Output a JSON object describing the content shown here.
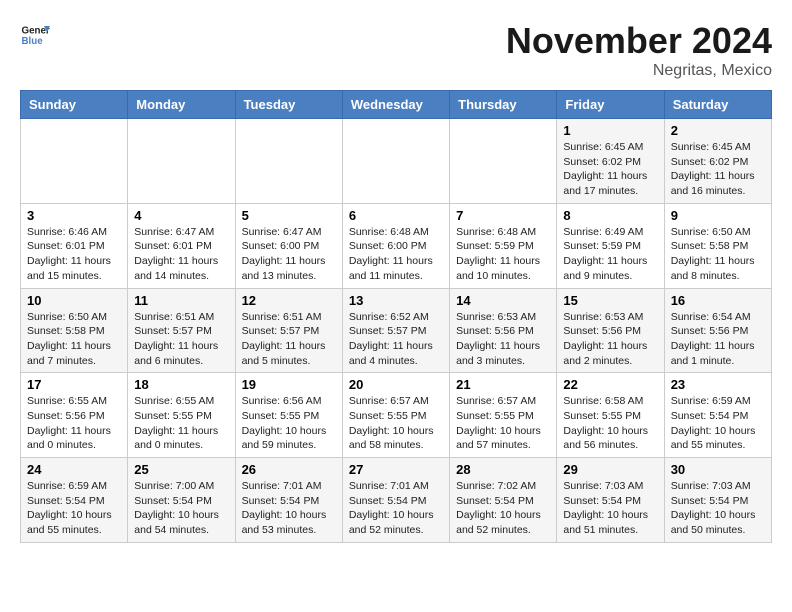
{
  "logo": {
    "line1": "General",
    "line2": "Blue"
  },
  "title": "November 2024",
  "location": "Negritas, Mexico",
  "days_header": [
    "Sunday",
    "Monday",
    "Tuesday",
    "Wednesday",
    "Thursday",
    "Friday",
    "Saturday"
  ],
  "weeks": [
    [
      {
        "day": "",
        "info": ""
      },
      {
        "day": "",
        "info": ""
      },
      {
        "day": "",
        "info": ""
      },
      {
        "day": "",
        "info": ""
      },
      {
        "day": "",
        "info": ""
      },
      {
        "day": "1",
        "info": "Sunrise: 6:45 AM\nSunset: 6:02 PM\nDaylight: 11 hours and 17 minutes."
      },
      {
        "day": "2",
        "info": "Sunrise: 6:45 AM\nSunset: 6:02 PM\nDaylight: 11 hours and 16 minutes."
      }
    ],
    [
      {
        "day": "3",
        "info": "Sunrise: 6:46 AM\nSunset: 6:01 PM\nDaylight: 11 hours and 15 minutes."
      },
      {
        "day": "4",
        "info": "Sunrise: 6:47 AM\nSunset: 6:01 PM\nDaylight: 11 hours and 14 minutes."
      },
      {
        "day": "5",
        "info": "Sunrise: 6:47 AM\nSunset: 6:00 PM\nDaylight: 11 hours and 13 minutes."
      },
      {
        "day": "6",
        "info": "Sunrise: 6:48 AM\nSunset: 6:00 PM\nDaylight: 11 hours and 11 minutes."
      },
      {
        "day": "7",
        "info": "Sunrise: 6:48 AM\nSunset: 5:59 PM\nDaylight: 11 hours and 10 minutes."
      },
      {
        "day": "8",
        "info": "Sunrise: 6:49 AM\nSunset: 5:59 PM\nDaylight: 11 hours and 9 minutes."
      },
      {
        "day": "9",
        "info": "Sunrise: 6:50 AM\nSunset: 5:58 PM\nDaylight: 11 hours and 8 minutes."
      }
    ],
    [
      {
        "day": "10",
        "info": "Sunrise: 6:50 AM\nSunset: 5:58 PM\nDaylight: 11 hours and 7 minutes."
      },
      {
        "day": "11",
        "info": "Sunrise: 6:51 AM\nSunset: 5:57 PM\nDaylight: 11 hours and 6 minutes."
      },
      {
        "day": "12",
        "info": "Sunrise: 6:51 AM\nSunset: 5:57 PM\nDaylight: 11 hours and 5 minutes."
      },
      {
        "day": "13",
        "info": "Sunrise: 6:52 AM\nSunset: 5:57 PM\nDaylight: 11 hours and 4 minutes."
      },
      {
        "day": "14",
        "info": "Sunrise: 6:53 AM\nSunset: 5:56 PM\nDaylight: 11 hours and 3 minutes."
      },
      {
        "day": "15",
        "info": "Sunrise: 6:53 AM\nSunset: 5:56 PM\nDaylight: 11 hours and 2 minutes."
      },
      {
        "day": "16",
        "info": "Sunrise: 6:54 AM\nSunset: 5:56 PM\nDaylight: 11 hours and 1 minute."
      }
    ],
    [
      {
        "day": "17",
        "info": "Sunrise: 6:55 AM\nSunset: 5:56 PM\nDaylight: 11 hours and 0 minutes."
      },
      {
        "day": "18",
        "info": "Sunrise: 6:55 AM\nSunset: 5:55 PM\nDaylight: 11 hours and 0 minutes."
      },
      {
        "day": "19",
        "info": "Sunrise: 6:56 AM\nSunset: 5:55 PM\nDaylight: 10 hours and 59 minutes."
      },
      {
        "day": "20",
        "info": "Sunrise: 6:57 AM\nSunset: 5:55 PM\nDaylight: 10 hours and 58 minutes."
      },
      {
        "day": "21",
        "info": "Sunrise: 6:57 AM\nSunset: 5:55 PM\nDaylight: 10 hours and 57 minutes."
      },
      {
        "day": "22",
        "info": "Sunrise: 6:58 AM\nSunset: 5:55 PM\nDaylight: 10 hours and 56 minutes."
      },
      {
        "day": "23",
        "info": "Sunrise: 6:59 AM\nSunset: 5:54 PM\nDaylight: 10 hours and 55 minutes."
      }
    ],
    [
      {
        "day": "24",
        "info": "Sunrise: 6:59 AM\nSunset: 5:54 PM\nDaylight: 10 hours and 55 minutes."
      },
      {
        "day": "25",
        "info": "Sunrise: 7:00 AM\nSunset: 5:54 PM\nDaylight: 10 hours and 54 minutes."
      },
      {
        "day": "26",
        "info": "Sunrise: 7:01 AM\nSunset: 5:54 PM\nDaylight: 10 hours and 53 minutes."
      },
      {
        "day": "27",
        "info": "Sunrise: 7:01 AM\nSunset: 5:54 PM\nDaylight: 10 hours and 52 minutes."
      },
      {
        "day": "28",
        "info": "Sunrise: 7:02 AM\nSunset: 5:54 PM\nDaylight: 10 hours and 52 minutes."
      },
      {
        "day": "29",
        "info": "Sunrise: 7:03 AM\nSunset: 5:54 PM\nDaylight: 10 hours and 51 minutes."
      },
      {
        "day": "30",
        "info": "Sunrise: 7:03 AM\nSunset: 5:54 PM\nDaylight: 10 hours and 50 minutes."
      }
    ]
  ]
}
